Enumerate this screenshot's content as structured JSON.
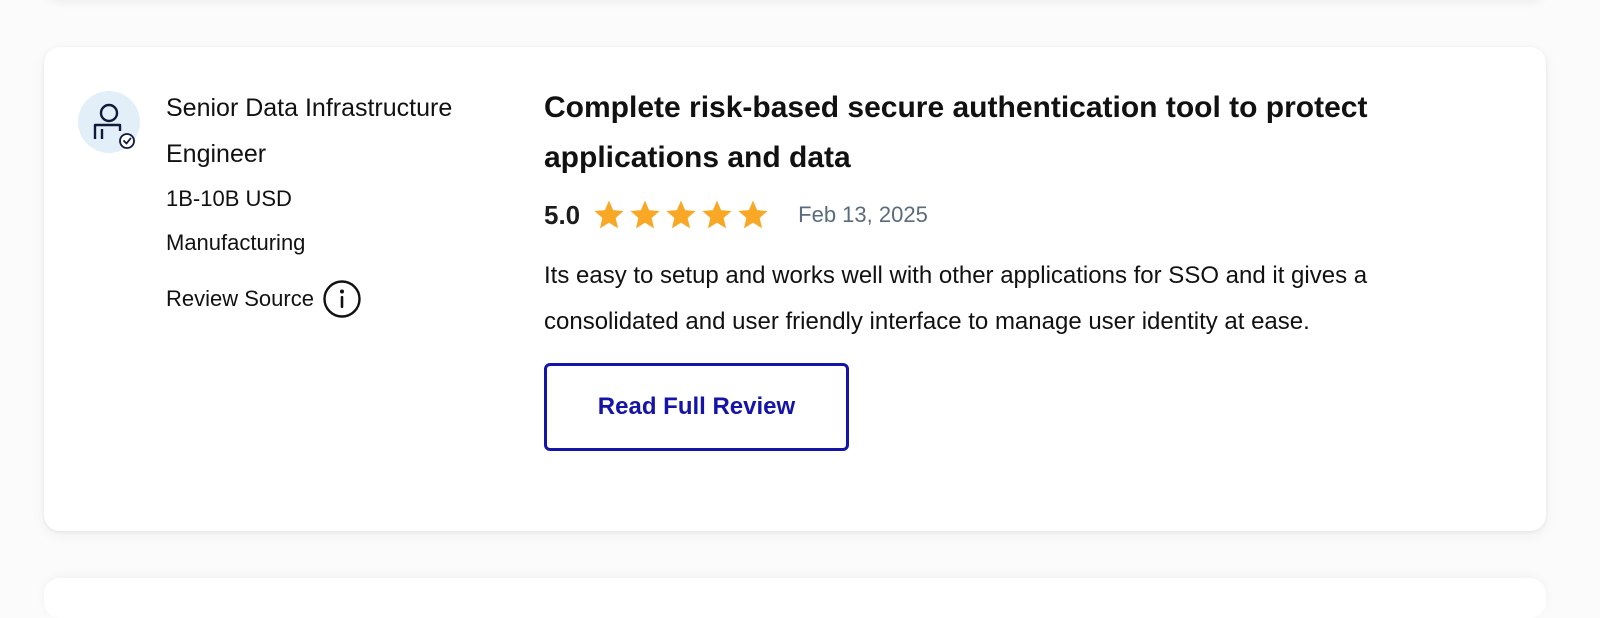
{
  "reviewer": {
    "avatar_icon": "user-verified-icon",
    "role": "Senior Data Infrastructure Engineer",
    "company_size": "1B-10B USD",
    "industry": "Manufacturing",
    "review_source_label": "Review Source",
    "info_icon": "info-icon"
  },
  "review": {
    "title": "Complete risk-based secure authentication tool to protect applications and data",
    "rating": "5.0",
    "rating_out_of": 5,
    "stars": 5,
    "date": "Feb 13, 2025",
    "body": "Its easy to setup and works well with other applications for SSO and it gives a consolidated and user friendly interface to manage user identity at ease.",
    "read_more_label": "Read Full Review"
  },
  "colors": {
    "star": "#F9A825",
    "button_accent": "#1414A8",
    "date_text": "#5A6B7D",
    "avatar_bg": "#E3EFF8"
  }
}
